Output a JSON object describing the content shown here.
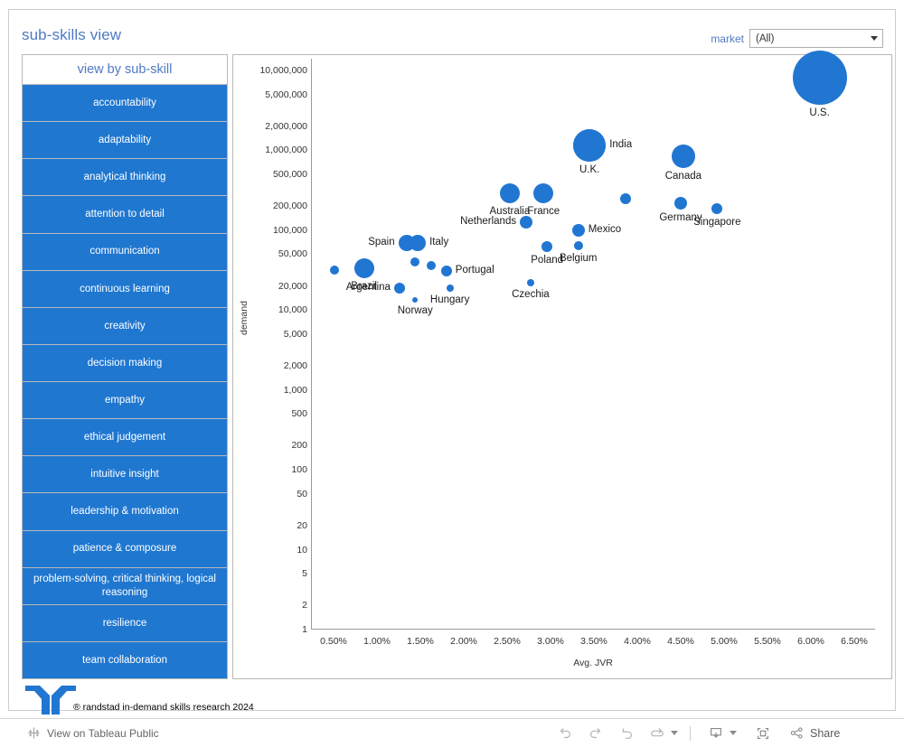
{
  "dashboard": {
    "title": "sub-skills view",
    "footer_credit": "® randstad in-demand skills research 2024"
  },
  "filter": {
    "label": "market",
    "value": "(All)",
    "caret_icon": "chevron-down-icon"
  },
  "sidebar": {
    "header": "view by sub-skill",
    "items": [
      {
        "label": "accountability"
      },
      {
        "label": "adaptability"
      },
      {
        "label": "analytical thinking"
      },
      {
        "label": "attention to detail"
      },
      {
        "label": "communication"
      },
      {
        "label": "continuous learning"
      },
      {
        "label": "creativity"
      },
      {
        "label": "decision making"
      },
      {
        "label": "empathy"
      },
      {
        "label": "ethical judgement"
      },
      {
        "label": "intuitive insight"
      },
      {
        "label": "leadership & motivation"
      },
      {
        "label": "patience & composure"
      },
      {
        "label": "problem-solving, critical thinking, logical reasoning"
      },
      {
        "label": "resilience"
      },
      {
        "label": "team collaboration"
      }
    ]
  },
  "toolbar": {
    "view_on_tableau_public": "View on Tableau Public",
    "share_label": "Share",
    "buttons": [
      "undo-icon",
      "redo-icon",
      "revert-icon",
      "refresh-icon",
      "pause-dropdown-caret",
      "download-icon",
      "fullscreen-icon",
      "share-icon"
    ]
  },
  "chart_data": {
    "type": "scatter",
    "title": "",
    "xlabel": "Avg. JVR",
    "ylabel": "demand",
    "x_unit": "percent",
    "y_scale": "log",
    "x_ticks": [
      "0.50%",
      "1.00%",
      "1.50%",
      "2.00%",
      "2.50%",
      "3.00%",
      "3.50%",
      "4.00%",
      "4.50%",
      "5.00%",
      "5.50%",
      "6.00%",
      "6.50%"
    ],
    "y_ticks": [
      "10,000,000",
      "5,000,000",
      "2,000,000",
      "1,000,000",
      "500,000",
      "200,000",
      "100,000",
      "50,000",
      "20,000",
      "10,000",
      "5,000",
      "2,000",
      "1,000",
      "500",
      "200",
      "100",
      "50",
      "20",
      "10",
      "5",
      "2",
      "1"
    ],
    "xlim": [
      0.25,
      6.75
    ],
    "ylim": [
      1,
      14000000
    ],
    "grid": false,
    "legend": false,
    "size_encodes": "demand",
    "point_color": "#2176d2",
    "points": [
      {
        "label": "U.S.",
        "x": 6.1,
        "y": 8000000,
        "r": 30,
        "label_pos": "below"
      },
      {
        "label": "India",
        "x": 3.45,
        "y": 1150000,
        "r": 18,
        "label_pos": "right"
      },
      {
        "label": "U.K.",
        "x": 3.45,
        "y": 1150000,
        "r": 18,
        "label_pos": "below"
      },
      {
        "label": "Canada",
        "x": 4.53,
        "y": 850000,
        "r": 13,
        "label_pos": "below"
      },
      {
        "label": "Australia",
        "x": 2.53,
        "y": 290000,
        "r": 11,
        "label_pos": "below"
      },
      {
        "label": "France",
        "x": 2.92,
        "y": 290000,
        "r": 11,
        "label_pos": "below"
      },
      {
        "label": "Germany",
        "x": 4.5,
        "y": 220000,
        "r": 7,
        "label_pos": "below"
      },
      {
        "label": "",
        "x": 3.86,
        "y": 250000,
        "r": 6,
        "label_pos": "none"
      },
      {
        "label": "Singapore",
        "x": 4.92,
        "y": 185000,
        "r": 6,
        "label_pos": "below"
      },
      {
        "label": "Netherlands",
        "x": 2.72,
        "y": 125000,
        "r": 7,
        "label_pos": "left"
      },
      {
        "label": "Mexico",
        "x": 3.32,
        "y": 100000,
        "r": 7,
        "label_pos": "right"
      },
      {
        "label": "Belgium",
        "x": 3.32,
        "y": 64000,
        "r": 5,
        "label_pos": "below"
      },
      {
        "label": "Poland",
        "x": 2.96,
        "y": 62000,
        "r": 6,
        "label_pos": "below"
      },
      {
        "label": "Spain",
        "x": 1.34,
        "y": 70000,
        "r": 9,
        "label_pos": "left"
      },
      {
        "label": "Italy",
        "x": 1.47,
        "y": 70000,
        "r": 9,
        "label_pos": "right"
      },
      {
        "label": "Brazil",
        "x": 0.85,
        "y": 33000,
        "r": 11,
        "label_pos": "below"
      },
      {
        "label": "",
        "x": 0.51,
        "y": 32000,
        "r": 5,
        "label_pos": "none"
      },
      {
        "label": "",
        "x": 1.44,
        "y": 40000,
        "r": 5,
        "label_pos": "none"
      },
      {
        "label": "",
        "x": 1.62,
        "y": 36000,
        "r": 5,
        "label_pos": "none"
      },
      {
        "label": "Portugal",
        "x": 1.8,
        "y": 31000,
        "r": 6,
        "label_pos": "right"
      },
      {
        "label": "Argentina",
        "x": 1.26,
        "y": 19000,
        "r": 6,
        "label_pos": "left"
      },
      {
        "label": "Hungary",
        "x": 1.84,
        "y": 19000,
        "r": 4,
        "label_pos": "below"
      },
      {
        "label": "Norway",
        "x": 1.44,
        "y": 13500,
        "r": 3,
        "label_pos": "below"
      },
      {
        "label": "Czechia",
        "x": 2.77,
        "y": 22000,
        "r": 4,
        "label_pos": "below"
      }
    ]
  }
}
